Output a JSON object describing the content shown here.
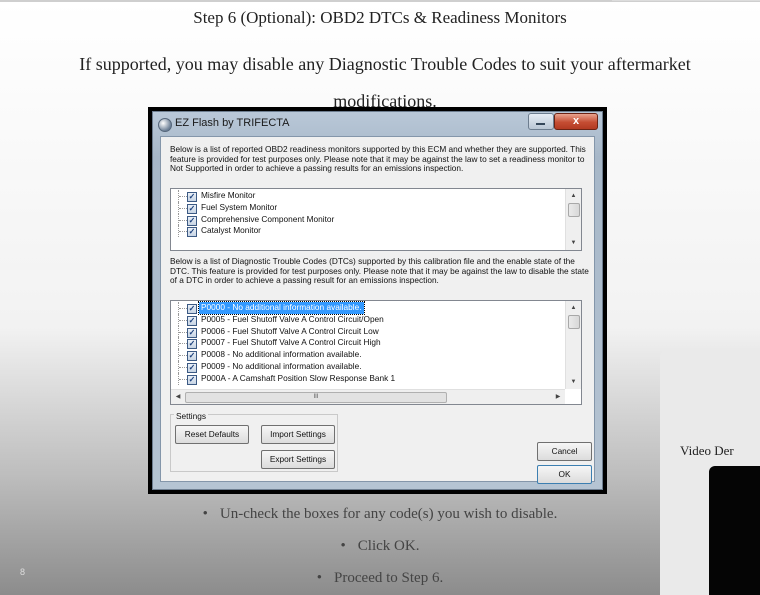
{
  "slide": {
    "step_title": "Step 6 (Optional): OBD2 DTCs & Readiness Monitors",
    "intro_line1": "If supported, you may disable any Diagnostic Trouble Codes to suit your aftermarket",
    "intro_line2": "modifications.",
    "page_number": "8",
    "bullets": [
      "Un-check the boxes for any code(s) you wish to disable.",
      "Click OK.",
      "Proceed to Step 6."
    ],
    "bullet_glyph": "•"
  },
  "window": {
    "title": "EZ Flash by TRIFECTA",
    "close_glyph": "x",
    "description1": "Below is a list of reported OBD2 readiness monitors supported by this ECM and whether they are supported.  This feature is provided for test purposes only.  Please note that it may be against the law to set a readiness monitor to Not Supported in order to achieve a passing results for an emissions inspection.",
    "monitors": [
      {
        "label": "Misfire Monitor",
        "checked": true
      },
      {
        "label": "Fuel System Monitor",
        "checked": true
      },
      {
        "label": "Comprehensive Component Monitor",
        "checked": true
      },
      {
        "label": "Catalyst Monitor",
        "checked": true
      }
    ],
    "description2": "Below is a list of Diagnostic Trouble Codes (DTCs) supported by this calibration file and the enable state of the DTC.  This feature is provided for test purposes only.  Please note that it may be against the law to disable the state of a DTC in order to achieve a passing result for an emissions inspection.",
    "dtcs": [
      {
        "label": "P0000 - No additional information available.",
        "checked": true,
        "selected": true
      },
      {
        "label": "P0005 - Fuel Shutoff Valve A Control Circuit/Open",
        "checked": true
      },
      {
        "label": "P0006 - Fuel Shutoff Valve A Control Circuit Low",
        "checked": true
      },
      {
        "label": "P0007 - Fuel Shutoff Valve A Control Circuit High",
        "checked": true
      },
      {
        "label": "P0008 - No additional information available.",
        "checked": true
      },
      {
        "label": "P0009 - No additional information available.",
        "checked": true
      },
      {
        "label": "P000A - A Camshaft Position Slow Response Bank 1",
        "checked": true
      }
    ],
    "check_glyph": "✓",
    "scroll_up_glyph": "▲",
    "scroll_down_glyph": "▼",
    "scroll_left_glyph": "◀",
    "scroll_right_glyph": "▶",
    "hscroll_grip": "III",
    "settings_label": "Settings",
    "reset_label": "Reset Defaults",
    "import_label": "Import Settings",
    "export_label": "Export Settings",
    "cancel_label": "Cancel",
    "ok_label": "OK"
  },
  "video_panel": {
    "label": "Video Der"
  }
}
